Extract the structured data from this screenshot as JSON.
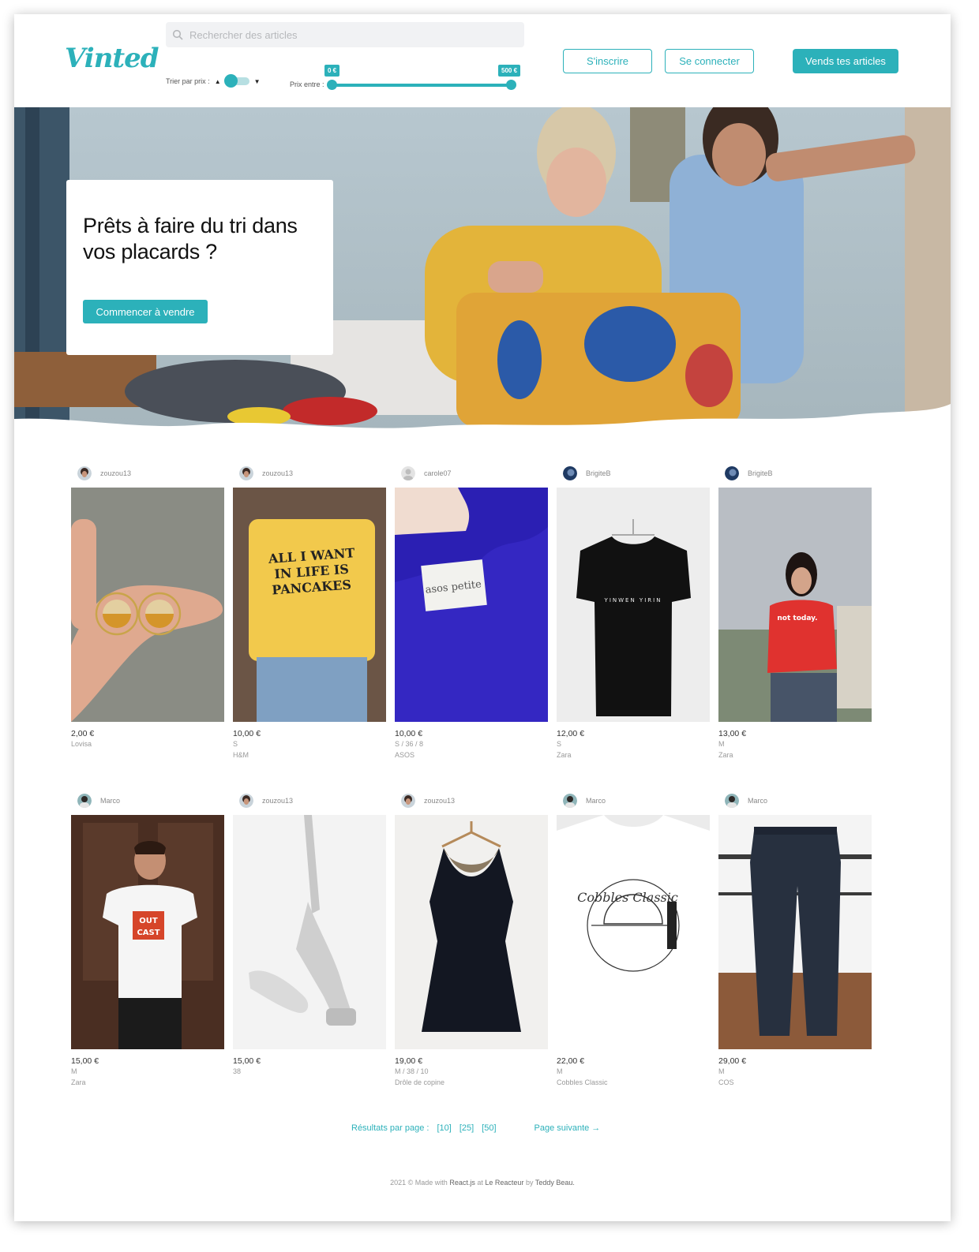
{
  "brand": {
    "logo": "Vinted",
    "accent_color": "#2cb1ba"
  },
  "header": {
    "search_placeholder": "Rechercher des articles",
    "sort_label": "Trier par prix :",
    "price_label": "Prix entre :",
    "price_min": "0 €",
    "price_max": "500 €",
    "signup": "S'inscrire",
    "login": "Se connecter",
    "sell": "Vends tes articles"
  },
  "hero": {
    "title": "Prêts à faire du tri dans vos placards ?",
    "cta": "Commencer à vendre"
  },
  "products": [
    {
      "user": "zouzou13",
      "price": "2,00 €",
      "size": "Lovisa",
      "brand": ""
    },
    {
      "user": "zouzou13",
      "price": "10,00 €",
      "size": "S",
      "brand": "H&M"
    },
    {
      "user": "carole07",
      "price": "10,00 €",
      "size": "S / 36 / 8",
      "brand": "ASOS"
    },
    {
      "user": "BrigiteB",
      "price": "12,00 €",
      "size": "S",
      "brand": "Zara"
    },
    {
      "user": "BrigiteB",
      "price": "13,00 €",
      "size": "M",
      "brand": "Zara"
    },
    {
      "user": "Marco",
      "price": "15,00 €",
      "size": "M",
      "brand": "Zara"
    },
    {
      "user": "zouzou13",
      "price": "15,00 €",
      "size": "38",
      "brand": ""
    },
    {
      "user": "zouzou13",
      "price": "19,00 €",
      "size": "M / 38 / 10",
      "brand": "Drôle de copine"
    },
    {
      "user": "Marco",
      "price": "22,00 €",
      "size": "M",
      "brand": "Cobbles Classic"
    },
    {
      "user": "Marco",
      "price": "29,00 €",
      "size": "M",
      "brand": "COS"
    }
  ],
  "pagination": {
    "label": "Résultats par page :",
    "options": [
      "[10]",
      "[25]",
      "[50]"
    ],
    "next": "Page suivante →"
  },
  "footer": {
    "prefix": "2021 © Made with",
    "tech": "React.js",
    "at": "at",
    "school": "Le Reacteur",
    "by": "by",
    "author": "Teddy Beau."
  }
}
